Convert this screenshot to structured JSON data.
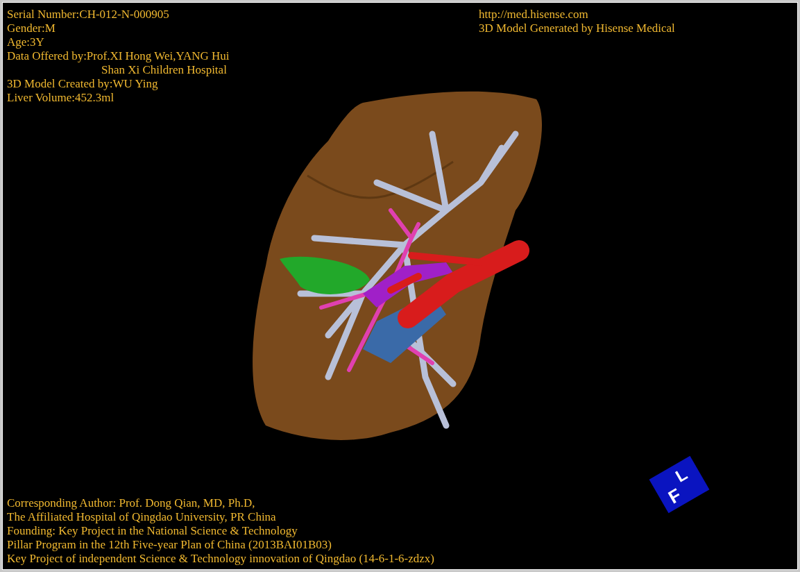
{
  "overlay_top_left": [
    {
      "kind": "line",
      "text": "Serial Number:CH-012-N-000905"
    },
    {
      "kind": "line",
      "text": "Gender:M"
    },
    {
      "kind": "line",
      "text": "Age:3Y"
    },
    {
      "kind": "line",
      "text": "Data Offered by:Prof.XI Hong Wei,YANG Hui"
    },
    {
      "kind": "continuation",
      "text": "Shan Xi Children Hospital"
    },
    {
      "kind": "line",
      "text": "3D Model Created by:WU Ying"
    },
    {
      "kind": "line",
      "text": "Liver Volume:452.3ml"
    }
  ],
  "overlay_top_right": [
    "http://med.hisense.com",
    "3D Model Generated by Hisense Medical"
  ],
  "overlay_bottom_left": [
    "Corresponding Author: Prof. Dong Qian, MD, Ph.D,",
    "The Affiliated Hospital of Qingdao University, PR China",
    "Founding: Key Project in the National Science & Technology",
    "Pillar Program in the 12th Five-year Plan of China (2013BAI01B03)",
    "Key Project of independent Science & Technology innovation of Qingdao (14-6-1-6-zdzx)"
  ],
  "orientation_cube": {
    "labels": [
      "F",
      "L"
    ]
  }
}
